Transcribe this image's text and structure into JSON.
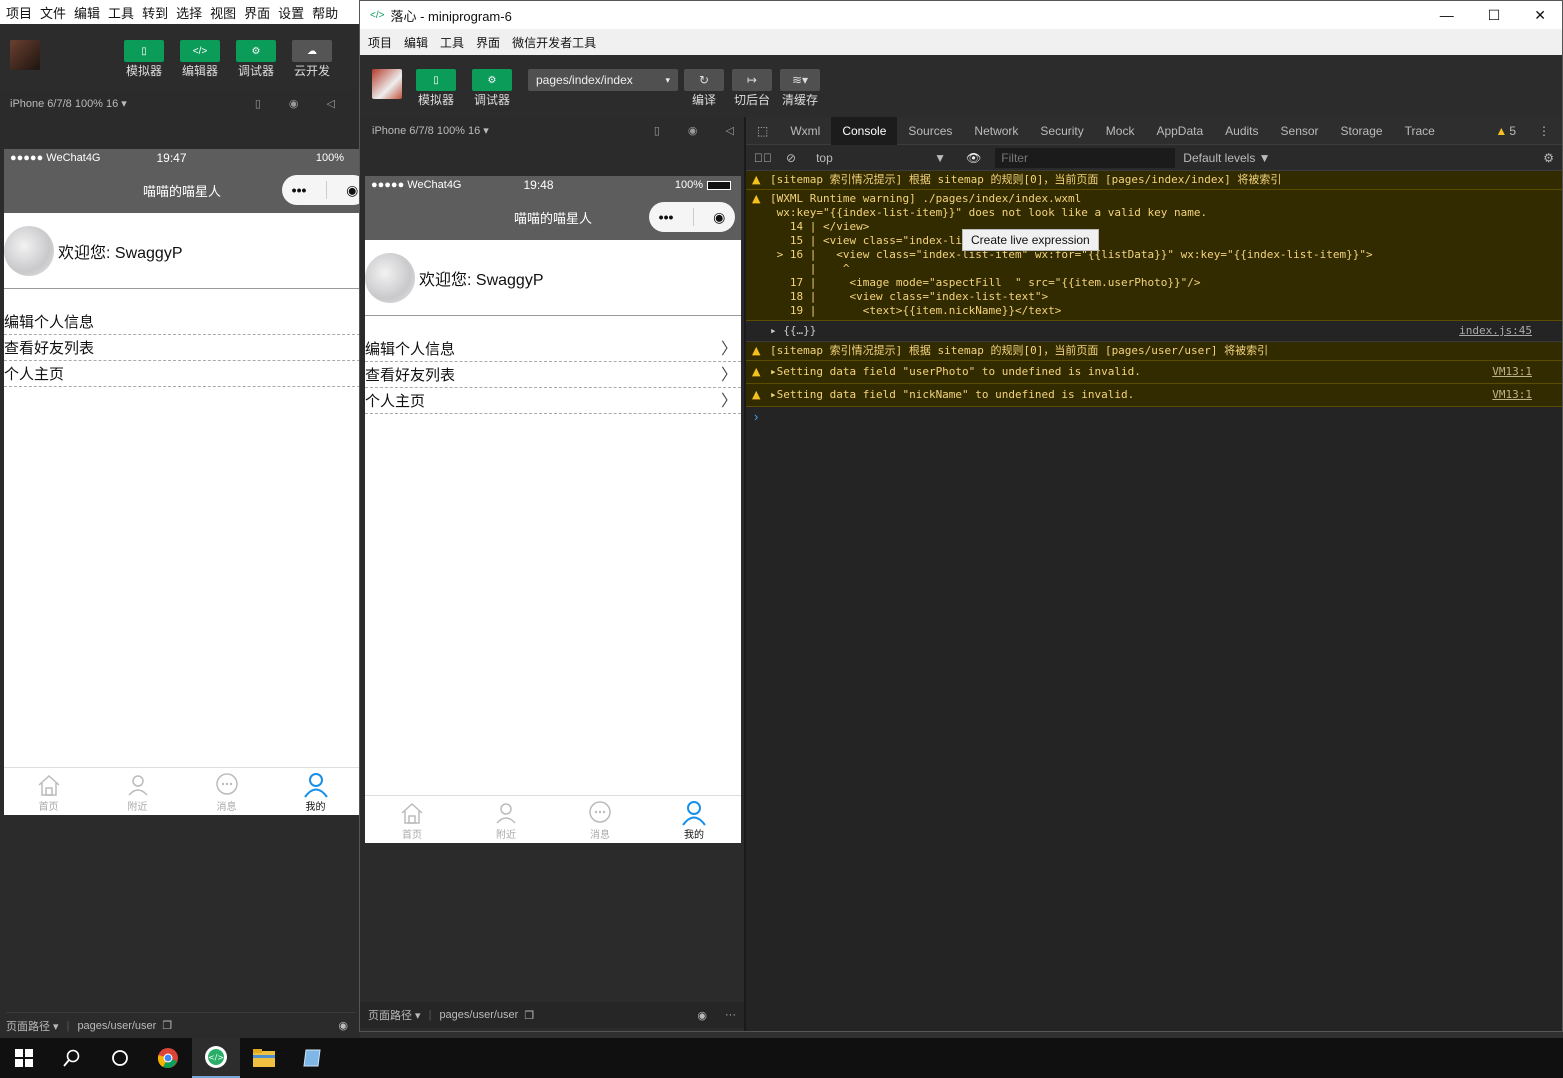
{
  "bg_app": {
    "menu": [
      "项目",
      "文件",
      "编辑",
      "工具",
      "转到",
      "选择",
      "视图",
      "界面",
      "设置",
      "帮助"
    ],
    "toolbar": [
      "模拟器",
      "编辑器",
      "调试器",
      "云开发"
    ],
    "device": "iPhone 6/7/8 100% 16 ▾",
    "status": {
      "carrier": "●●●●● WeChat4G",
      "time": "19:47",
      "battery": "100%"
    },
    "footer": {
      "path_label": "页面路径 ▾",
      "path": "pages/user/user"
    }
  },
  "phone": {
    "nav_title": "喵喵的喵星人",
    "capsule_more": "•••",
    "welcome": "欢迎您: SwaggyP",
    "items": [
      "编辑个人信息",
      "查看好友列表",
      "个人主页"
    ],
    "tabs": [
      "首页",
      "附近",
      "消息",
      "我的"
    ]
  },
  "window": {
    "title": "落心 - miniprogram-6",
    "menu": [
      "项目",
      "编辑",
      "工具",
      "界面",
      "微信开发者工具"
    ],
    "toolbar": {
      "simulator": "模拟器",
      "debugger": "调试器",
      "page_path": "pages/index/index",
      "compile": "编译",
      "background": "切后台",
      "clear_cache": "清缓存"
    },
    "device": "iPhone 6/7/8 100% 16 ▾",
    "status": {
      "carrier": "●●●●● WeChat4G",
      "time": "19:48",
      "battery": "100%"
    },
    "footer": {
      "path_label": "页面路径 ▾",
      "path": "pages/user/user"
    }
  },
  "devtools": {
    "tabs": [
      "Wxml",
      "Console",
      "Sources",
      "Network",
      "Security",
      "Mock",
      "AppData",
      "Audits",
      "Sensor",
      "Storage",
      "Trace"
    ],
    "active_tab": "Console",
    "warn_count": "5",
    "context": "top",
    "filter_placeholder": "Filter",
    "levels": "Default levels ▼",
    "tooltip": "Create live expression",
    "messages": [
      {
        "type": "warn",
        "text": "[sitemap 索引情况提示] 根据 sitemap 的规则[0]，当前页面 [pages/index/index] 将被索引",
        "src": ""
      },
      {
        "type": "warn",
        "text": "[WXML Runtime warning] ./pages/index/index.wxml\n wx:key=\"{{index-list-item}}\" does not look like a valid key name.\n   14 | </view>\n   15 | <view class=\"index-list\">\n > 16 |   <view class=\"index-list-item\" wx:for=\"{{listData}}\" wx:key=\"{{index-list-item}}\">\n      |    ^\n   17 |     <image mode=\"aspectFill  \" src=\"{{item.userPhoto}}\"/>\n   18 |     <view class=\"index-list-text\">\n   19 |       <text>{{item.nickName}}</text>",
        "src": ""
      },
      {
        "type": "log",
        "text": "▸ {{…}}",
        "src": "index.js:45"
      },
      {
        "type": "warn",
        "text": "[sitemap 索引情况提示] 根据 sitemap 的规则[0]，当前页面 [pages/user/user] 将被索引",
        "src": ""
      },
      {
        "type": "warn",
        "text": "▸Setting data field \"userPhoto\" to undefined is invalid.",
        "src": "VM13:1"
      },
      {
        "type": "warn",
        "text": "▸Setting data field \"nickName\" to undefined is invalid.",
        "src": "VM13:1"
      }
    ],
    "prompt": "›"
  },
  "colors": {
    "accent": "#0c9c5a",
    "warn_bg": "#332b00",
    "warn_text": "#f3d37c",
    "tab_active": "#1aad19"
  }
}
